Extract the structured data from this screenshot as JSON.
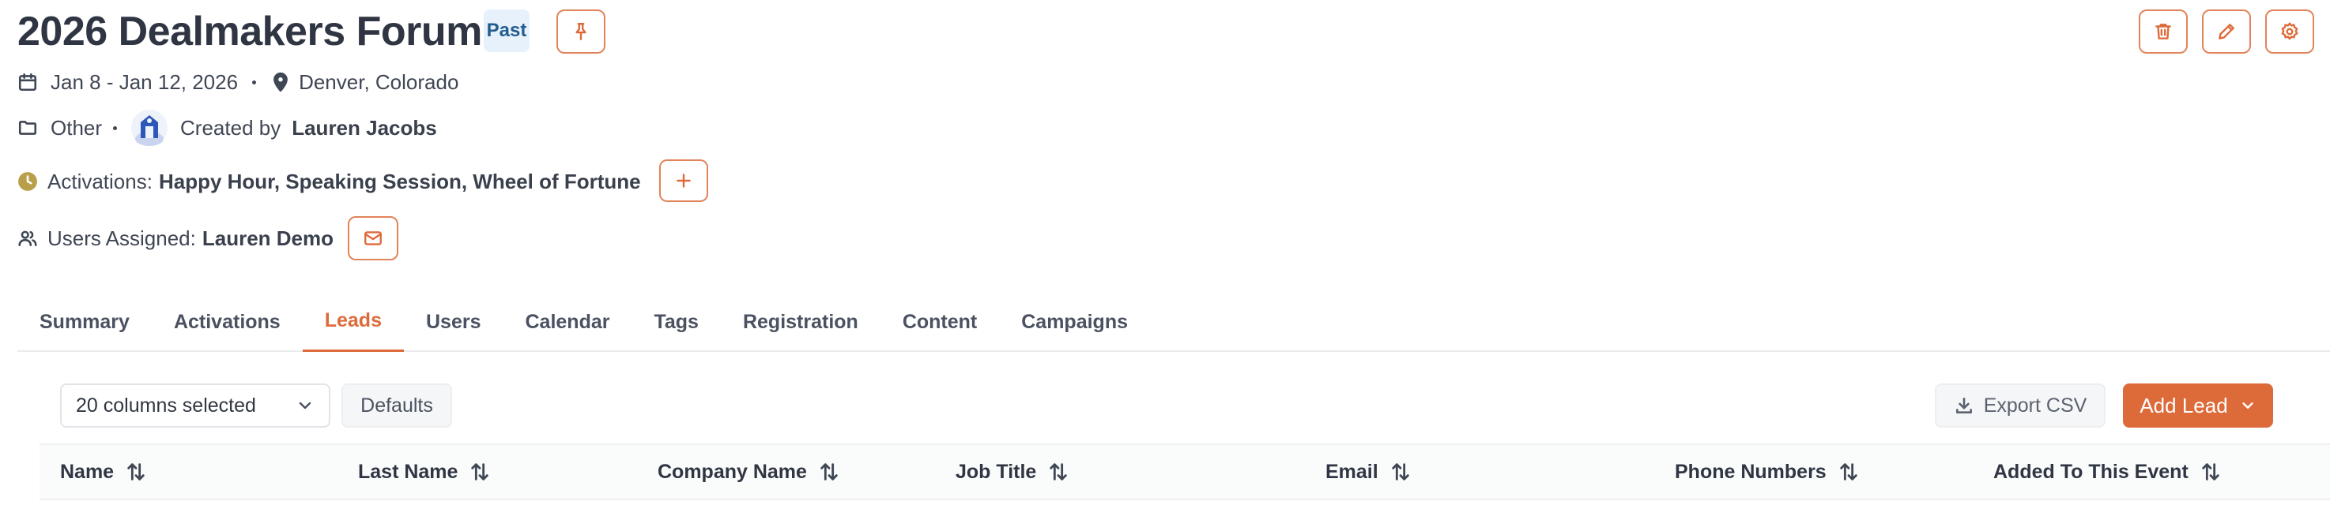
{
  "event": {
    "title": "2026 Dealmakers Forum",
    "status_badge": "Past",
    "dates": "Jan 8 - Jan 12, 2026",
    "location": "Denver, Colorado",
    "category": "Other",
    "created_by_label": "Created by",
    "created_by_name": "Lauren Jacobs",
    "activations_label": "Activations:",
    "activations_value": "Happy Hour, Speaking Session, Wheel of Fortune",
    "users_assigned_label": "Users Assigned:",
    "users_assigned_value": "Lauren Demo"
  },
  "header_actions": [
    "trash-icon",
    "pencil-icon",
    "gear-icon"
  ],
  "tabs": [
    {
      "label": "Summary"
    },
    {
      "label": "Activations"
    },
    {
      "label": "Leads",
      "active": true
    },
    {
      "label": "Users"
    },
    {
      "label": "Calendar"
    },
    {
      "label": "Tags"
    },
    {
      "label": "Registration"
    },
    {
      "label": "Content"
    },
    {
      "label": "Campaigns"
    }
  ],
  "toolbar": {
    "columns_select": "20 columns selected",
    "defaults_label": "Defaults",
    "export_label": "Export CSV",
    "add_lead_label": "Add Lead"
  },
  "table": {
    "columns": [
      "Name",
      "Last Name",
      "Company Name",
      "Job Title",
      "Email",
      "Phone Numbers",
      "Added To This Event"
    ]
  },
  "colors": {
    "accent": "#dd6b3a",
    "badge_bg": "#e6f1fb",
    "badge_text": "#235c8f",
    "activation_icon": "#b8a04a"
  }
}
